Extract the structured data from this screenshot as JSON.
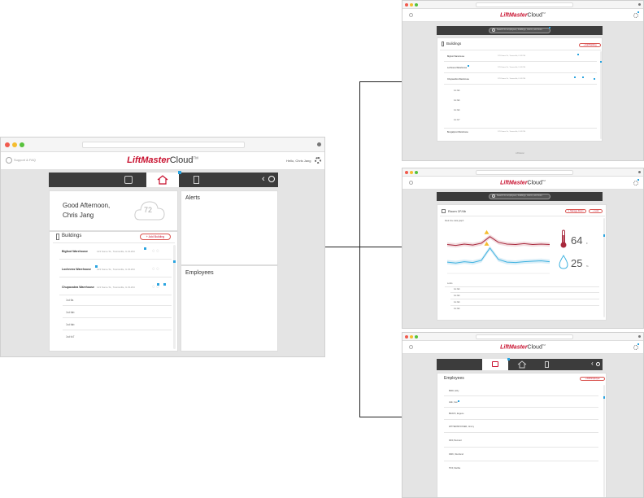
{
  "brand": {
    "name": "LiftMaster",
    "suffix": "Cloud"
  },
  "main": {
    "support_link": "Support & FAQ",
    "greeting_user": "Hello, Chris Jang",
    "greeting_line1": "Good Afternoon,",
    "greeting_line2": "Chris Jang",
    "weather_temp": "72",
    "alerts_title": "Alerts",
    "employees_title": "Employees",
    "buildings_title": "Buildings",
    "add_building": "Add Building",
    "buildings": [
      {
        "name": "Bigfoot Warehouse",
        "address": "123 Some St., Townsville, IL 61234"
      },
      {
        "name": "Lochness Warehouse",
        "address": "123 Some St., Townsville, IL 61234"
      },
      {
        "name": "Chupacabra Warehouse",
        "address": "123 Some St., Townsville, IL 61234"
      }
    ],
    "rooms": [
      "1st fla",
      "1st fab",
      "1st fab",
      "1st fo7"
    ]
  },
  "top": {
    "buildings_title": "Buildings",
    "add_building": "Add Building",
    "search_placeholder": "Search for employees, buildings, rooms, and more",
    "buildings": [
      {
        "name": "Bigfoot Warehouse",
        "address": "123 Some St., Townsville, IL 61234"
      },
      {
        "name": "Lochness Warehouse",
        "address": "123 Some St., Townsville, IL 61234"
      },
      {
        "name": "Chupacabra Warehouse",
        "address": "123 Some St., Townsville, IL 61234"
      },
      {
        "name": "Bengalpost Warehouse",
        "address": "123 Some St., Townsville, IL 61234"
      }
    ],
    "rooms": [
      "1st fab",
      "1st fab",
      "1st fab",
      "1st fo7"
    ],
    "footer": "LiftMaster"
  },
  "middle": {
    "room_title": "Room 1F/4b",
    "manage_btn": "Manage Room",
    "lock_btn": "Lock",
    "chart_caption": "Real time data graph",
    "temperature": "64",
    "temperature_unit": "F",
    "humidity": "25",
    "humidity_unit": "%",
    "list_header": "Locks",
    "list": [
      "1st fab",
      "1st fab",
      "1st fab",
      "1st fab"
    ]
  },
  "bottom": {
    "employees_title": "Employees",
    "add_employee": "Add Employee",
    "employees": [
      "BIRD, Ethy",
      "LEE, Ivan",
      "BRAVO, Eugene",
      "WITHERSPOONER, Jimmy",
      "RIFF, Bernard",
      "DIRK, Wentlund",
      "TIFF, Martha"
    ]
  },
  "colors": {
    "brand_red": "#c8102e",
    "accent_blue": "#2aa4e0",
    "dark_nav": "#3c3c3c",
    "temp_line": "#a8283c",
    "humidity_line": "#3fb2e0"
  },
  "chart_data": {
    "type": "line",
    "title": "Real time data graph",
    "x": [
      0,
      1,
      2,
      3,
      4,
      5,
      6,
      7,
      8,
      9,
      10,
      11,
      12
    ],
    "series": [
      {
        "values": [
          6.2,
          6.0,
          6.3,
          6.1,
          6.5,
          8.0,
          6.7,
          6.3,
          6.2,
          6.4,
          6.2,
          6.3,
          6.2
        ]
      },
      {
        "values": [
          2.2,
          2.0,
          2.3,
          2.1,
          2.6,
          5.4,
          2.8,
          2.2,
          2.1,
          2.3,
          2.4,
          2.5,
          2.3
        ]
      }
    ],
    "ylim": [
      0,
      10
    ],
    "grid": false
  }
}
